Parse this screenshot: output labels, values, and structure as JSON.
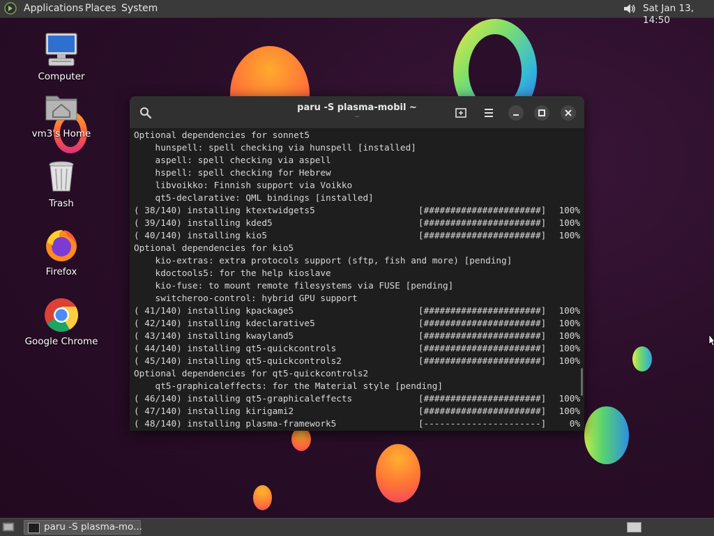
{
  "top_panel": {
    "menus": [
      "Applications",
      "Places",
      "System"
    ],
    "clock": "Sat Jan 13, 14:50"
  },
  "desktop_icons": [
    {
      "label": "Computer",
      "icon": "computer-icon"
    },
    {
      "label": "vm3's Home",
      "icon": "home-folder-icon"
    },
    {
      "label": "Trash",
      "icon": "trash-icon"
    },
    {
      "label": "Firefox",
      "icon": "firefox-icon"
    },
    {
      "label": "Google Chrome",
      "icon": "chrome-icon"
    }
  ],
  "terminal": {
    "title": "paru -S plasma-mobil ~",
    "subtitle": "~",
    "lines": [
      {
        "text": "Optional dependencies for sonnet5"
      },
      {
        "text": "    hunspell: spell checking via hunspell [installed]"
      },
      {
        "text": "    aspell: spell checking via aspell"
      },
      {
        "text": "    hspell: spell checking for Hebrew"
      },
      {
        "text": "    libvoikko: Finnish support via Voikko"
      },
      {
        "text": "    qt5-declarative: QML bindings [installed]"
      },
      {
        "text": "( 38/140) installing ktextwidgets5",
        "bar": "[######################]",
        "pct": "100%"
      },
      {
        "text": "( 39/140) installing kded5",
        "bar": "[######################]",
        "pct": "100%"
      },
      {
        "text": "( 40/140) installing kio5",
        "bar": "[######################]",
        "pct": "100%"
      },
      {
        "text": "Optional dependencies for kio5"
      },
      {
        "text": "    kio-extras: extra protocols support (sftp, fish and more) [pending]"
      },
      {
        "text": "    kdoctools5: for the help kioslave"
      },
      {
        "text": "    kio-fuse: to mount remote filesystems via FUSE [pending]"
      },
      {
        "text": "    switcheroo-control: hybrid GPU support"
      },
      {
        "text": "( 41/140) installing kpackage5",
        "bar": "[######################]",
        "pct": "100%"
      },
      {
        "text": "( 42/140) installing kdeclarative5",
        "bar": "[######################]",
        "pct": "100%"
      },
      {
        "text": "( 43/140) installing kwayland5",
        "bar": "[######################]",
        "pct": "100%"
      },
      {
        "text": "( 44/140) installing qt5-quickcontrols",
        "bar": "[######################]",
        "pct": "100%"
      },
      {
        "text": "( 45/140) installing qt5-quickcontrols2",
        "bar": "[######################]",
        "pct": "100%"
      },
      {
        "text": "Optional dependencies for qt5-quickcontrols2"
      },
      {
        "text": "    qt5-graphicaleffects: for the Material style [pending]"
      },
      {
        "text": "( 46/140) installing qt5-graphicaleffects",
        "bar": "[######################]",
        "pct": "100%"
      },
      {
        "text": "( 47/140) installing kirigami2",
        "bar": "[######################]",
        "pct": "100%"
      },
      {
        "text": "( 48/140) installing plasma-framework5",
        "bar": "[----------------------]",
        "pct": "0%"
      }
    ]
  },
  "taskbar": {
    "task_label": "paru -S plasma-mo..."
  }
}
